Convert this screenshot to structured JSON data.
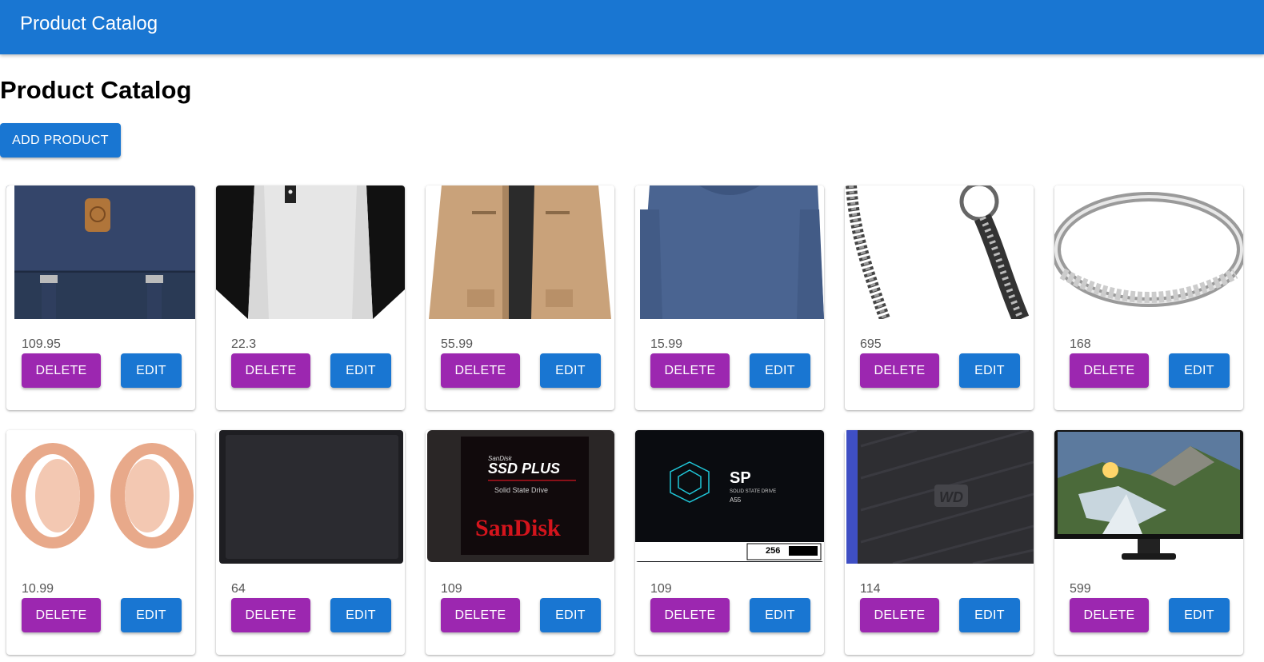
{
  "appbar": {
    "title": "Product Catalog"
  },
  "page": {
    "heading": "Product Catalog",
    "add_button_label": "ADD PRODUCT"
  },
  "colors": {
    "primary": "#1976d2",
    "secondary": "#9c27b0"
  },
  "products": [
    {
      "price": "109.95",
      "image": "navy-backpack",
      "delete_label": "DELETE",
      "edit_label": "EDIT"
    },
    {
      "price": "22.3",
      "image": "raglan-henley-shirt",
      "delete_label": "DELETE",
      "edit_label": "EDIT"
    },
    {
      "price": "55.99",
      "image": "khaki-jacket",
      "delete_label": "DELETE",
      "edit_label": "EDIT"
    },
    {
      "price": "15.99",
      "image": "blue-long-sleeve-shirt",
      "delete_label": "DELETE",
      "edit_label": "EDIT"
    },
    {
      "price": "695",
      "image": "silver-chain-bracelet",
      "delete_label": "DELETE",
      "edit_label": "EDIT"
    },
    {
      "price": "168",
      "image": "diamond-ring",
      "delete_label": "DELETE",
      "edit_label": "EDIT"
    },
    {
      "price": "10.99",
      "image": "rose-gold-plugs",
      "delete_label": "DELETE",
      "edit_label": "EDIT"
    },
    {
      "price": "64",
      "image": "black-hard-drive",
      "delete_label": "DELETE",
      "edit_label": "EDIT"
    },
    {
      "price": "109",
      "image": "sandisk-ssd",
      "delete_label": "DELETE",
      "edit_label": "EDIT",
      "image_text": [
        "SanDisk",
        "SSD PLUS",
        "Solid State Drive",
        "SanDisk"
      ]
    },
    {
      "price": "109",
      "image": "silicon-power-ssd",
      "delete_label": "DELETE",
      "edit_label": "EDIT",
      "image_text": [
        "SP",
        "SOLID STATE DRIVE",
        "A55",
        "256"
      ]
    },
    {
      "price": "114",
      "image": "wd-external-drive",
      "delete_label": "DELETE",
      "edit_label": "EDIT",
      "image_text": [
        "WD"
      ]
    },
    {
      "price": "599",
      "image": "acer-monitor",
      "delete_label": "DELETE",
      "edit_label": "EDIT"
    }
  ]
}
